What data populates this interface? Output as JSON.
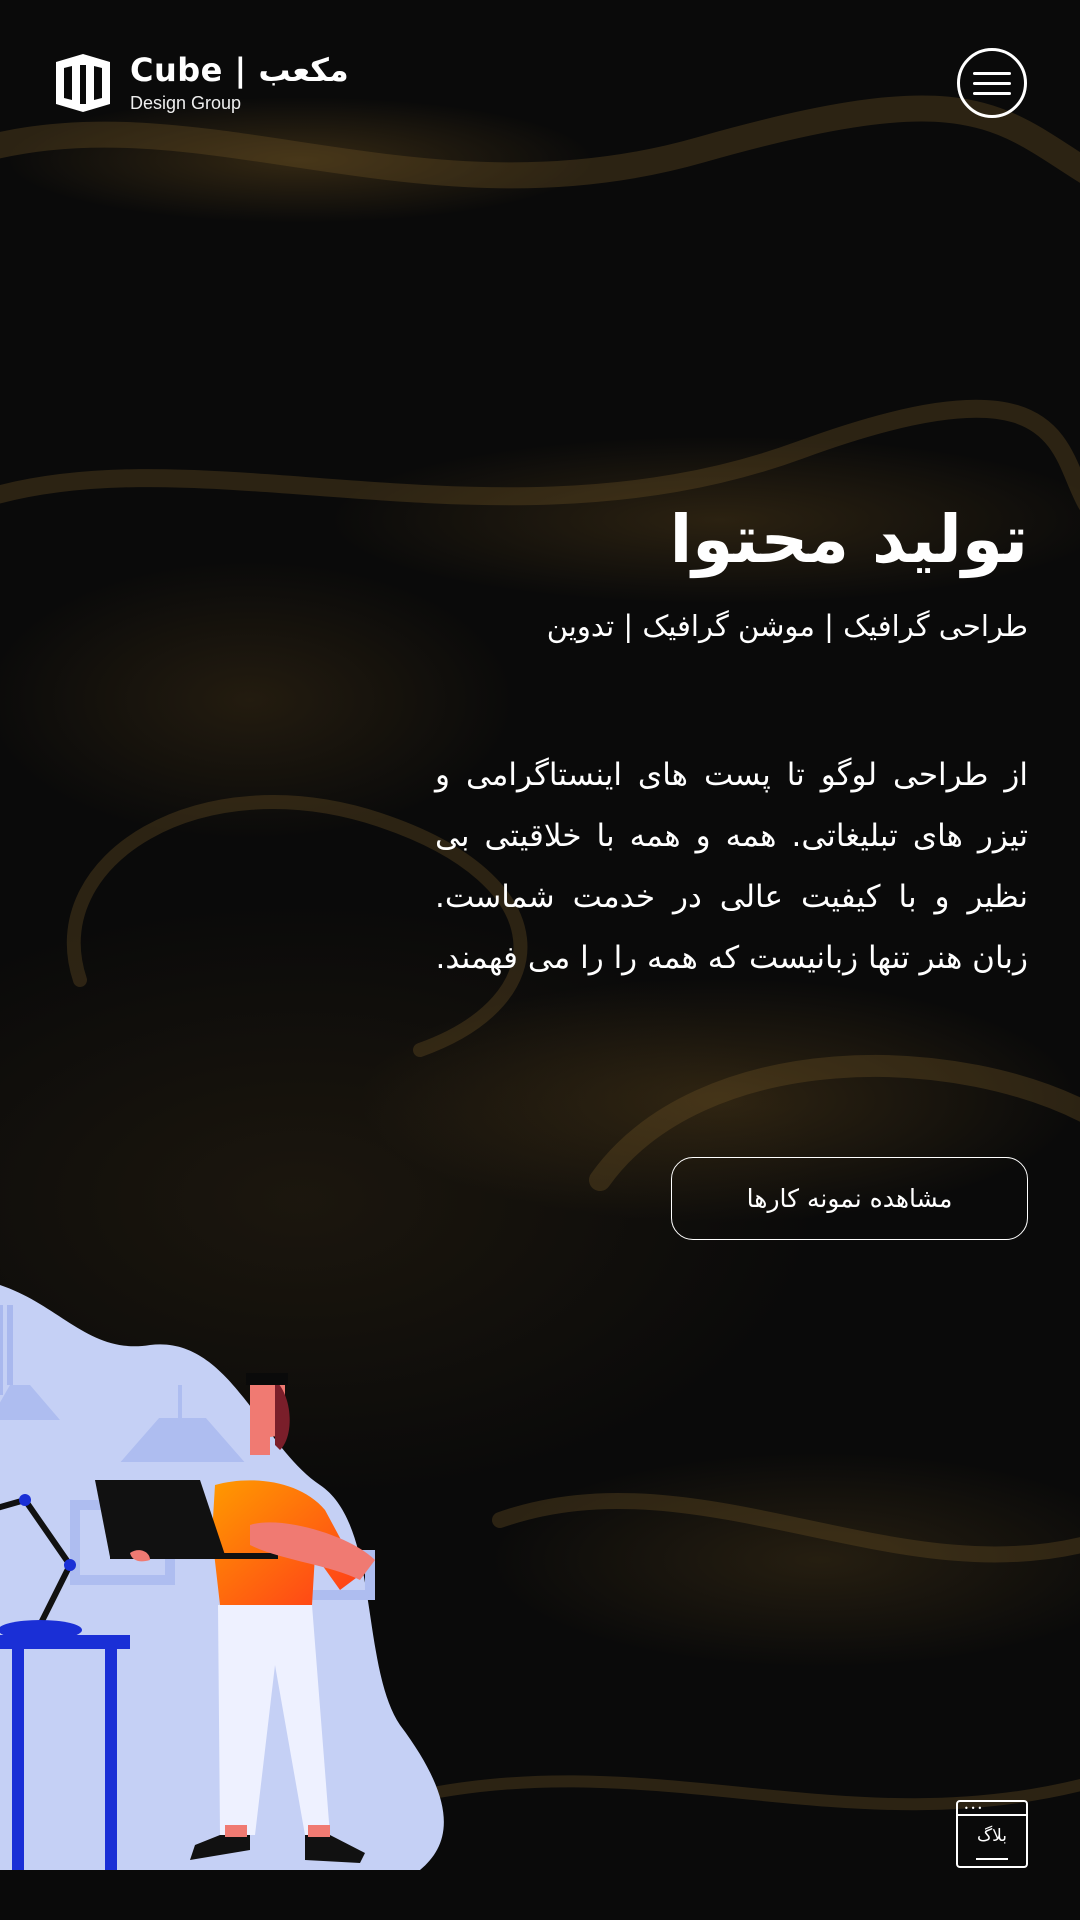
{
  "brand": {
    "title": "Cube | مکعب",
    "subtitle": "Design Group"
  },
  "header": {
    "menu_icon": "hamburger-menu-icon"
  },
  "hero": {
    "title": "تولید محتوا",
    "subtitle": "طراحی گرافیک | موشن گرافیک | تدوین",
    "description": "از طراحی لوگو تا پست های اینستاگرامی و تیزر های تبلیغاتی. همه و همه با خلاقیتی بی نظیر و با کیفیت عالی در خدمت شماست. زبان هنر تنها زبانیست که همه را را می فهمند.",
    "cta_label": "مشاهده نمونه کارها"
  },
  "blog": {
    "label": "بلاگ",
    "icon": "blog-window-icon"
  },
  "colors": {
    "background": "#070707",
    "accent_gold": "#8a6a2a",
    "illustration_blue": "#c5d0f5",
    "shirt_orange": "#ff6a00",
    "desk_blue": "#1a2fd6"
  }
}
